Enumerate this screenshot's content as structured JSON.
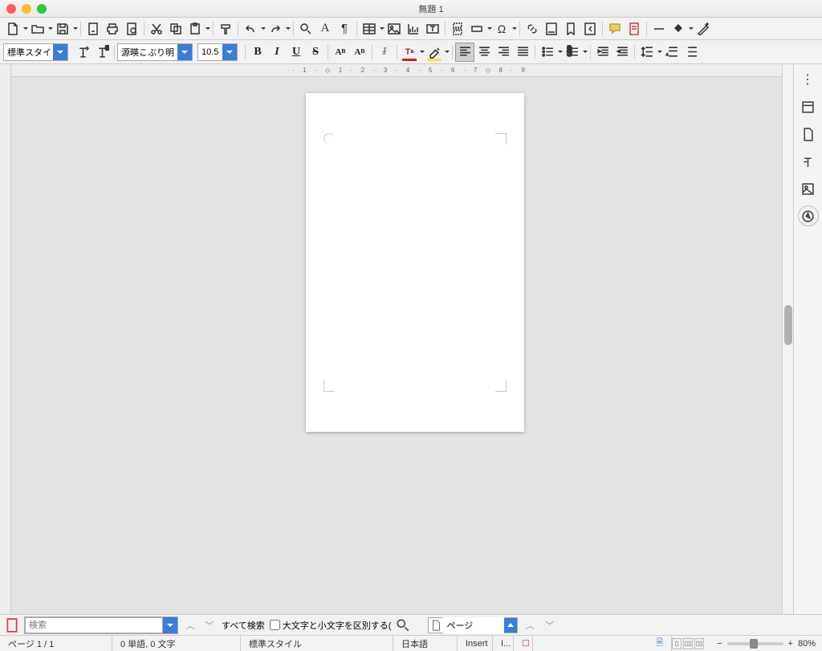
{
  "window": {
    "title": "無題 1"
  },
  "format": {
    "paragraph_style": "標準スタイル",
    "font_name": "源暎こぶり明朝",
    "font_size": "10.5"
  },
  "ruler": {
    "ticks": [
      "1",
      "",
      "1",
      "2",
      "3",
      "4",
      "5",
      "6",
      "7",
      "8",
      "9"
    ]
  },
  "find": {
    "placeholder": "検索",
    "find_all": "すべて検索",
    "match_case": "大文字と小文字を区別する(",
    "page_label": "ページ"
  },
  "status": {
    "page": "ページ 1 / 1",
    "words": "0 単語, 0 文字",
    "style": "標準スタイル",
    "lang": "日本語",
    "insert": "Insert",
    "overwrite": "I...",
    "zoom": "80%"
  }
}
